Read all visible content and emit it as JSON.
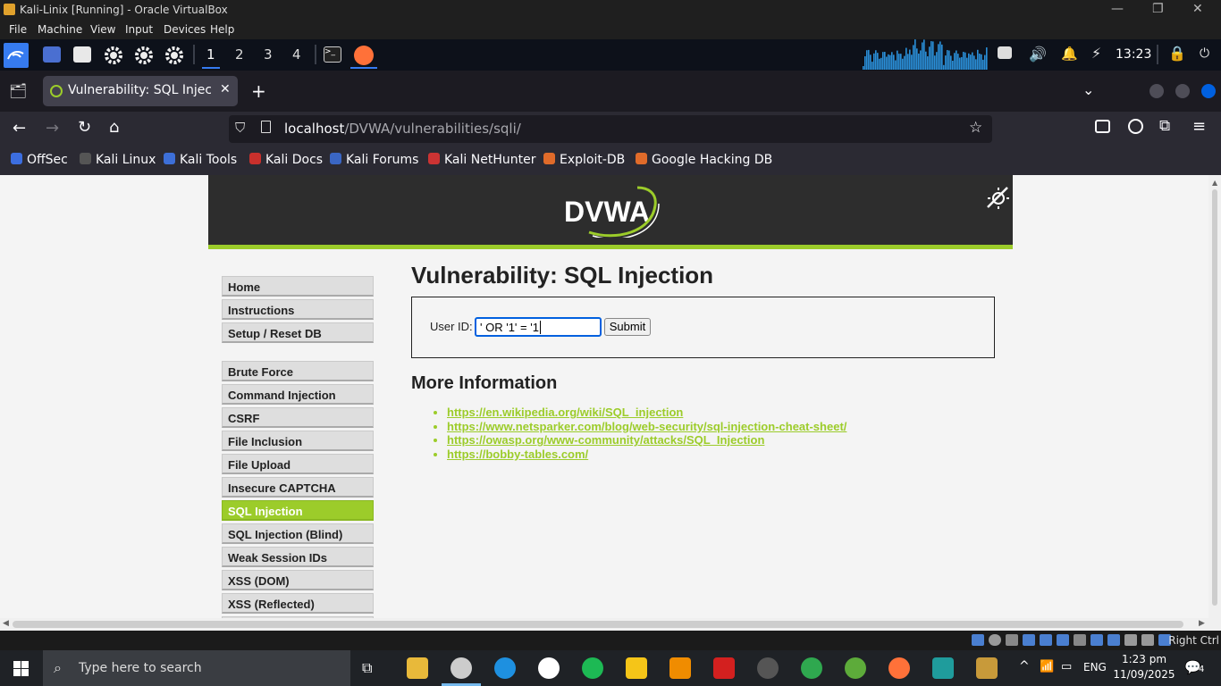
{
  "vbox": {
    "title": "Kali-Linix [Running] - Oracle VirtualBox",
    "menu": [
      "File",
      "Machine",
      "View",
      "Input",
      "Devices",
      "Help"
    ],
    "host_key": "Right Ctrl"
  },
  "kali_panel": {
    "workspaces": [
      "1",
      "2",
      "3",
      "4"
    ],
    "time": "13:23"
  },
  "browser": {
    "tab_title": "Vulnerability: SQL Injectio",
    "url_host": "localhost",
    "url_path": "/DVWA/vulnerabilities/sqli/",
    "bookmarks": [
      "OffSec",
      "Kali Linux",
      "Kali Tools",
      "Kali Docs",
      "Kali Forums",
      "Kali NetHunter",
      "Exploit-DB",
      "Google Hacking DB"
    ]
  },
  "dvwa": {
    "logo": "DVWA",
    "menu_top": [
      "Home",
      "Instructions",
      "Setup / Reset DB"
    ],
    "menu_vulns": [
      "Brute Force",
      "Command Injection",
      "CSRF",
      "File Inclusion",
      "File Upload",
      "Insecure CAPTCHA",
      "SQL Injection",
      "SQL Injection (Blind)",
      "Weak Session IDs",
      "XSS (DOM)",
      "XSS (Reflected)"
    ],
    "active_item": "SQL Injection",
    "page_title": "Vulnerability: SQL Injection",
    "form": {
      "label": "User ID:",
      "value": "' OR '1' = '1",
      "submit": "Submit"
    },
    "more_info_title": "More Information",
    "links": [
      "https://en.wikipedia.org/wiki/SQL_injection",
      "https://www.netsparker.com/blog/web-security/sql-injection-cheat-sheet/",
      "https://owasp.org/www-community/attacks/SQL_Injection",
      "https://bobby-tables.com/"
    ]
  },
  "taskbar": {
    "search_placeholder": "Type here to search",
    "lang": "ENG",
    "time": "1:23 pm",
    "date": "11/09/2025",
    "notifications": "4"
  },
  "colors": {
    "dvwa_green": "#9ccc2a",
    "dvwa_header": "#2d2d2d",
    "ff_dark": "#2b2a33",
    "kali_blue": "#367bf0"
  }
}
